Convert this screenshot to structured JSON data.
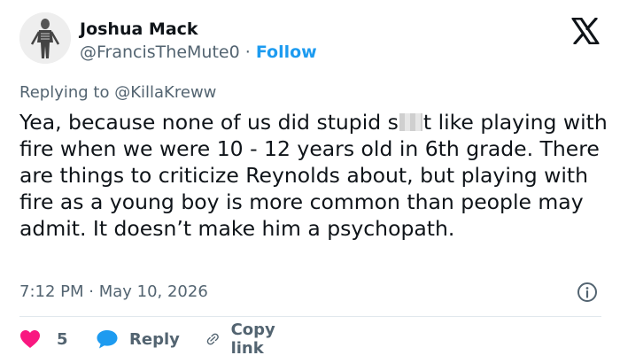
{
  "user": {
    "name": "Joshua Mack",
    "handle": "@FrancisTheMute0",
    "separator": "·",
    "follow_label": "Follow"
  },
  "reply_context": {
    "prefix": "Replying to",
    "mention": "@KillaKreww"
  },
  "tweet": {
    "text_before_censor": "Yea, because none of us did stupid s",
    "text_after_censor": "t like playing with fire when we were 10 - 12 years old in 6th grade. There are things to criticize Reynolds about, but playing with fire as a young boy is more common than people may admit. It doesn’t make him a psychopath.",
    "timestamp": "7:12 PM · May 10, 2026"
  },
  "actions": {
    "like_count": "5",
    "reply_label": "Reply",
    "copy_link_label": "Copy link"
  },
  "colors": {
    "accent": "#1d9bf0",
    "like": "#f91880",
    "muted": "#536471",
    "text": "#0f1419"
  },
  "icons": [
    "x-logo-icon",
    "info-icon",
    "heart-icon",
    "speech-bubble-icon",
    "link-icon"
  ]
}
